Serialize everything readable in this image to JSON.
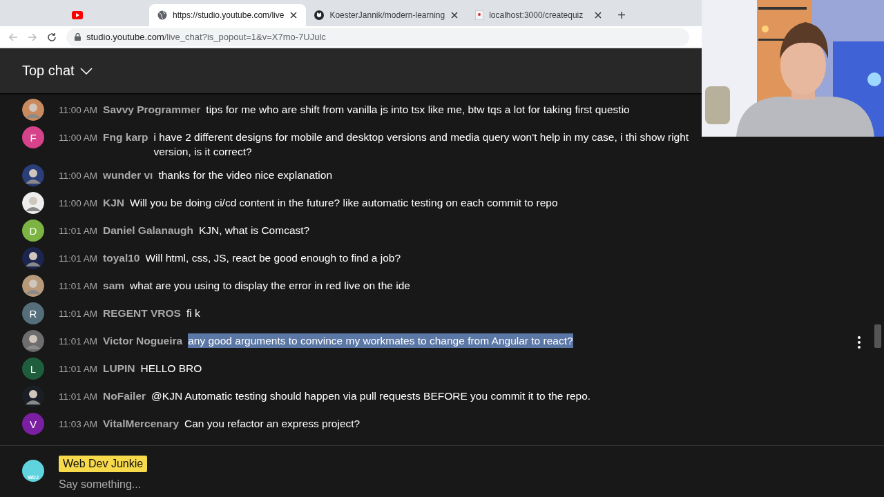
{
  "browser": {
    "tabs": [
      {
        "kind": "pinned",
        "selected": false
      },
      {
        "kind": "globe",
        "title": "https://studio.youtube.com/live",
        "selected": true
      },
      {
        "kind": "github",
        "title": "KoesterJannik/modern-learning",
        "selected": false
      },
      {
        "kind": "page",
        "title": "localhost:3000/createquiz",
        "selected": false
      }
    ],
    "new_tab": "+",
    "address": {
      "host": "studio.youtube.com",
      "path": "/live_chat?is_popout=1&v=X7mo-7UJulc"
    },
    "back_disabled": true,
    "forward_disabled": true
  },
  "chat": {
    "title": "Top chat",
    "messages": [
      {
        "time": "11:00 AM",
        "author": "Savvy Programmer",
        "text": "tips for me who are shift from vanilla js into tsx like me, btw tqs a lot for taking first questio",
        "highlighted": false,
        "hovered": false
      },
      {
        "avatar": {
          "kind": "letter",
          "letter": "F",
          "color": "#d6438a"
        },
        "time": "11:00 AM",
        "author": "Fng karp",
        "text": "i have 2 different designs for mobile and desktop versions and media query won't help in my case, i thi show right version, is it correct?",
        "highlighted": false,
        "hovered": false
      },
      {
        "time": "11:00 AM",
        "author": "wunder vı",
        "text": "thanks for the video nice explanation",
        "highlighted": false,
        "hovered": false
      },
      {
        "time": "11:00 AM",
        "author": "KJN",
        "text": "Will you be doing ci/cd content in the future? like automatic testing on each commit to repo",
        "highlighted": false,
        "hovered": false
      },
      {
        "avatar": {
          "kind": "letter",
          "letter": "D",
          "color": "#7cb342"
        },
        "time": "11:01 AM",
        "author": "Daniel Galanaugh",
        "text": "KJN, what is Comcast?",
        "highlighted": false,
        "hovered": false
      },
      {
        "time": "11:01 AM",
        "author": "toyal10",
        "text": "Will html, css, JS, react be good enough to find a job?",
        "highlighted": false,
        "hovered": false
      },
      {
        "time": "11:01 AM",
        "author": "sam",
        "text": "what are you using to display the error in red live on the ide",
        "highlighted": false,
        "hovered": false
      },
      {
        "avatar": {
          "kind": "letter",
          "letter": "R",
          "color": "#546e7a"
        },
        "time": "11:01 AM",
        "author": "REGENT VROS",
        "text": "fi k",
        "highlighted": false,
        "hovered": false
      },
      {
        "time": "11:01 AM",
        "author": "Victor Nogueira",
        "text": "any good arguments to convince my workmates to change from Angular to react?",
        "highlighted": true,
        "hovered": true
      },
      {
        "avatar": {
          "kind": "letter",
          "letter": "L",
          "color": "#1e5e3c"
        },
        "time": "11:01 AM",
        "author": "LUPIN",
        "text": "HELLO BRO",
        "highlighted": false,
        "hovered": false
      },
      {
        "time": "11:01 AM",
        "author": "NoFailer",
        "text": "@KJN Automatic testing should happen via pull requests BEFORE you commit it to the repo.",
        "highlighted": false,
        "hovered": false
      },
      {
        "avatar": {
          "kind": "letter",
          "letter": "V",
          "color": "#7b1fa2"
        },
        "time": "11:03 AM",
        "author": "VitalMercenary",
        "text": "Can you refactor an express project?",
        "highlighted": false,
        "hovered": false
      }
    ],
    "composer": {
      "avatar_label": "WDJ",
      "channel": "Web Dev Junkie",
      "placeholder": "Say something..."
    }
  }
}
